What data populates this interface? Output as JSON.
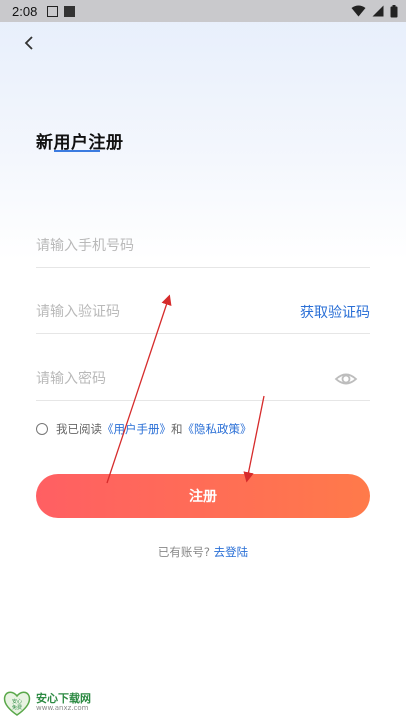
{
  "status_bar": {
    "time": "2:08",
    "icons": [
      "a-notification-icon",
      "photo-notification-icon",
      "wifi-icon",
      "signal-icon",
      "battery-icon"
    ]
  },
  "header": {
    "back_icon": "chevron-left-icon",
    "title": "新用户注册",
    "accent_color": "#3b7be0"
  },
  "form": {
    "phone_placeholder": "请输入手机号码",
    "code_placeholder": "请输入验证码",
    "get_code_label": "获取验证码",
    "password_placeholder": "请输入密码",
    "password_toggle_icon": "eye-icon"
  },
  "agreement": {
    "prefix": "我已阅读",
    "user_manual": "《用户手册》",
    "and": "和",
    "privacy_policy": "《隐私政策》",
    "checked": false
  },
  "submit": {
    "label": "注册",
    "gradient_start": "#ff5f63",
    "gradient_end": "#ff7a4a"
  },
  "login_prompt": {
    "text": "已有账号?",
    "link": "去登陆"
  },
  "watermark": {
    "logo_text": "安心 免费",
    "title": "安心下载网",
    "url": "www.anxz.com"
  },
  "colors": {
    "link": "#2a6fd6",
    "annotation_arrow": "#d62b2b"
  }
}
